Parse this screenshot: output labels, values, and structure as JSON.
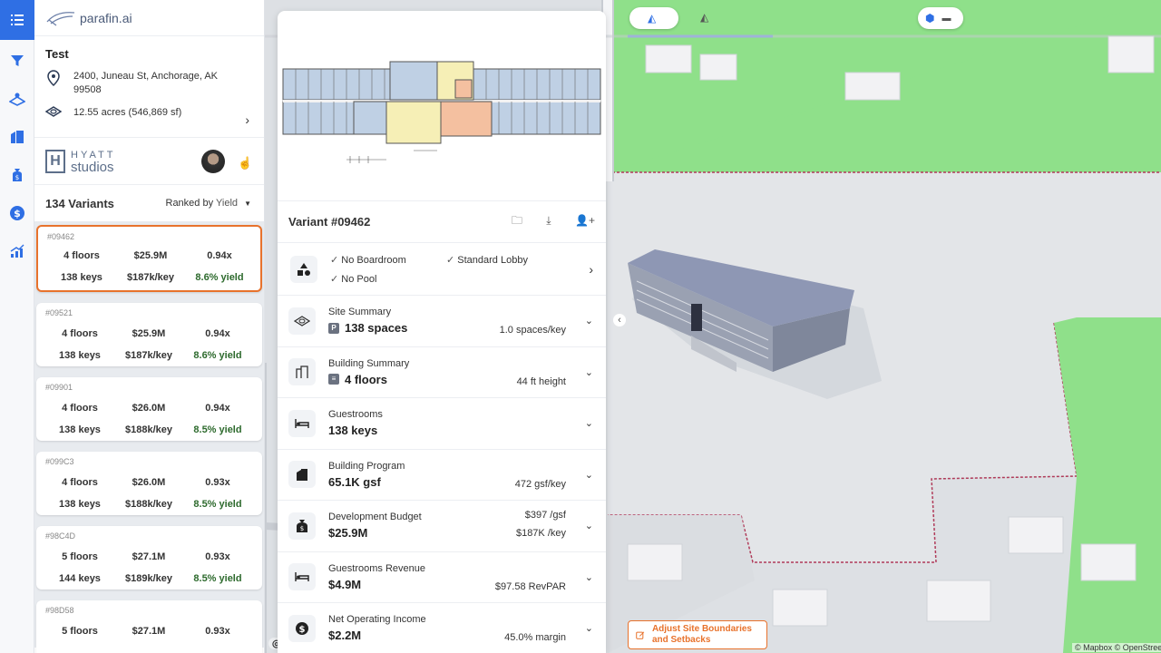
{
  "app": {
    "logo_text": "parafin.ai"
  },
  "project": {
    "name": "Test",
    "address": "2400, Juneau St, Anchorage, AK 99508",
    "acreage": "12.55 acres (546,869 sf)"
  },
  "brand": {
    "line1": "HYATT",
    "line2": "studios"
  },
  "variants": {
    "count_label": "134 Variants",
    "ranked_label": "Ranked by",
    "ranked_value": "Yield",
    "cards": [
      {
        "id": "#09462",
        "floors": "4 floors",
        "cost": "$25.9M",
        "ratio": "0.94x",
        "keys": "138 keys",
        "per_key": "$187k/key",
        "yield": "8.6% yield"
      },
      {
        "id": "#09521",
        "floors": "4 floors",
        "cost": "$25.9M",
        "ratio": "0.94x",
        "keys": "138 keys",
        "per_key": "$187k/key",
        "yield": "8.6% yield"
      },
      {
        "id": "#09901",
        "floors": "4 floors",
        "cost": "$26.0M",
        "ratio": "0.94x",
        "keys": "138 keys",
        "per_key": "$188k/key",
        "yield": "8.5% yield"
      },
      {
        "id": "#099C3",
        "floors": "4 floors",
        "cost": "$26.0M",
        "ratio": "0.93x",
        "keys": "138 keys",
        "per_key": "$188k/key",
        "yield": "8.5% yield"
      },
      {
        "id": "#98C4D",
        "floors": "5 floors",
        "cost": "$27.1M",
        "ratio": "0.93x",
        "keys": "144 keys",
        "per_key": "$189k/key",
        "yield": "8.5% yield"
      },
      {
        "id": "#98D58",
        "floors": "5 floors",
        "cost": "$27.1M",
        "ratio": "0.93x",
        "keys": "",
        "per_key": "",
        "yield": ""
      }
    ]
  },
  "detail": {
    "title": "Variant #09462",
    "amenities": [
      "No Boardroom",
      "Standard Lobby",
      "No Pool"
    ],
    "sections": [
      {
        "title": "Site Summary",
        "value": "138 spaces",
        "tag": "P",
        "right1": "1.0 spaces/key",
        "right2": ""
      },
      {
        "title": "Building Summary",
        "value": "4 floors",
        "tag": "≡",
        "right1": "44 ft height",
        "right2": ""
      },
      {
        "title": "Guestrooms",
        "value": "138 keys",
        "tag": "",
        "right1": "",
        "right2": ""
      },
      {
        "title": "Building Program",
        "value": "65.1K gsf",
        "tag": "",
        "right1": "472 gsf/key",
        "right2": ""
      },
      {
        "title": "Development Budget",
        "value": "$25.9M",
        "tag": "",
        "right1": "$397 /gsf",
        "right2": "$187K /key"
      },
      {
        "title": "Guestrooms Revenue",
        "value": "$4.9M",
        "tag": "",
        "right1": "$97.58 RevPAR",
        "right2": ""
      },
      {
        "title": "Net Operating Income",
        "value": "$2.2M",
        "tag": "",
        "right1": "45.0% margin",
        "right2": ""
      }
    ]
  },
  "map": {
    "adjust_button": "Adjust Site Boundaries and Setbacks",
    "mapbox_label": "mapbox",
    "attribution": "© Mapbox © OpenStreetMap"
  },
  "colors": {
    "accent": "#e8722c",
    "primary": "#2f6fe4",
    "grass": "#8fe08a"
  }
}
